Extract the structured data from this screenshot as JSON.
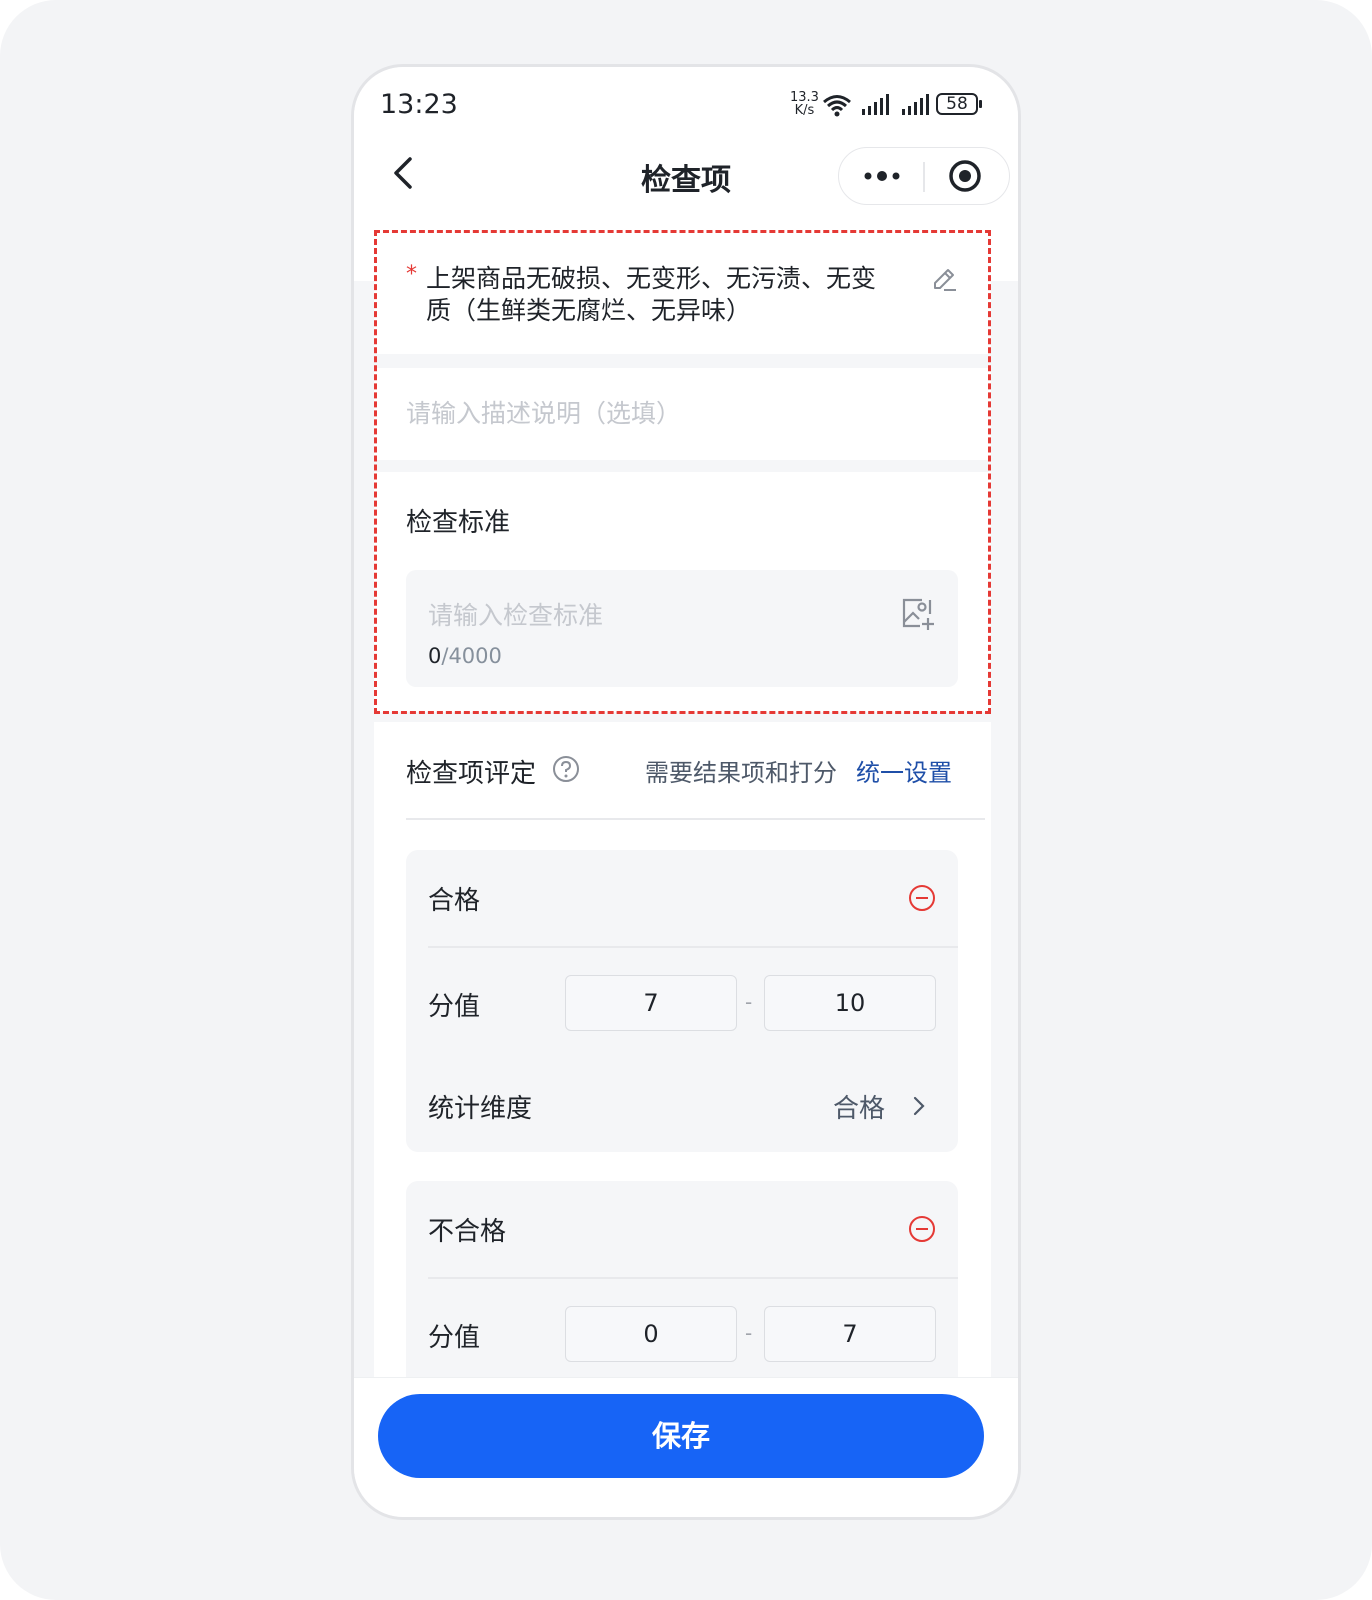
{
  "status_bar": {
    "time": "13:23",
    "speed_value": "13.3",
    "speed_unit": "K/s",
    "battery": "58",
    "icons": [
      "wifi-icon",
      "signal-icon",
      "signal-icon",
      "battery-icon"
    ]
  },
  "nav": {
    "title": "检查项",
    "back_icon": "chevron-left-icon",
    "more_icon": "more-dots-icon",
    "close_icon": "target-icon"
  },
  "item": {
    "required_mark": "*",
    "title": "上架商品无破损、无变形、无污渍、无变质（生鲜类无腐烂、无异味）",
    "description_placeholder": "请输入描述说明（选填）"
  },
  "standard": {
    "label": "检查标准",
    "placeholder": "请输入检查标准",
    "count": "0",
    "max": "/4000"
  },
  "evaluation": {
    "label": "检查项评定",
    "hint": "需要结果项和打分",
    "link": "统一设置"
  },
  "results": [
    {
      "name": "合格",
      "score_label": "分值",
      "score_min": "7",
      "score_max": "10",
      "dimension_label": "统计维度",
      "dimension_value": "合格"
    },
    {
      "name": "不合格",
      "score_label": "分值",
      "score_min": "0",
      "score_max": "7"
    }
  ],
  "range_separator": "-",
  "footer": {
    "save_label": "保存"
  },
  "colors": {
    "primary": "#1764f6",
    "danger": "#e53935",
    "link": "#1f4fa8"
  }
}
